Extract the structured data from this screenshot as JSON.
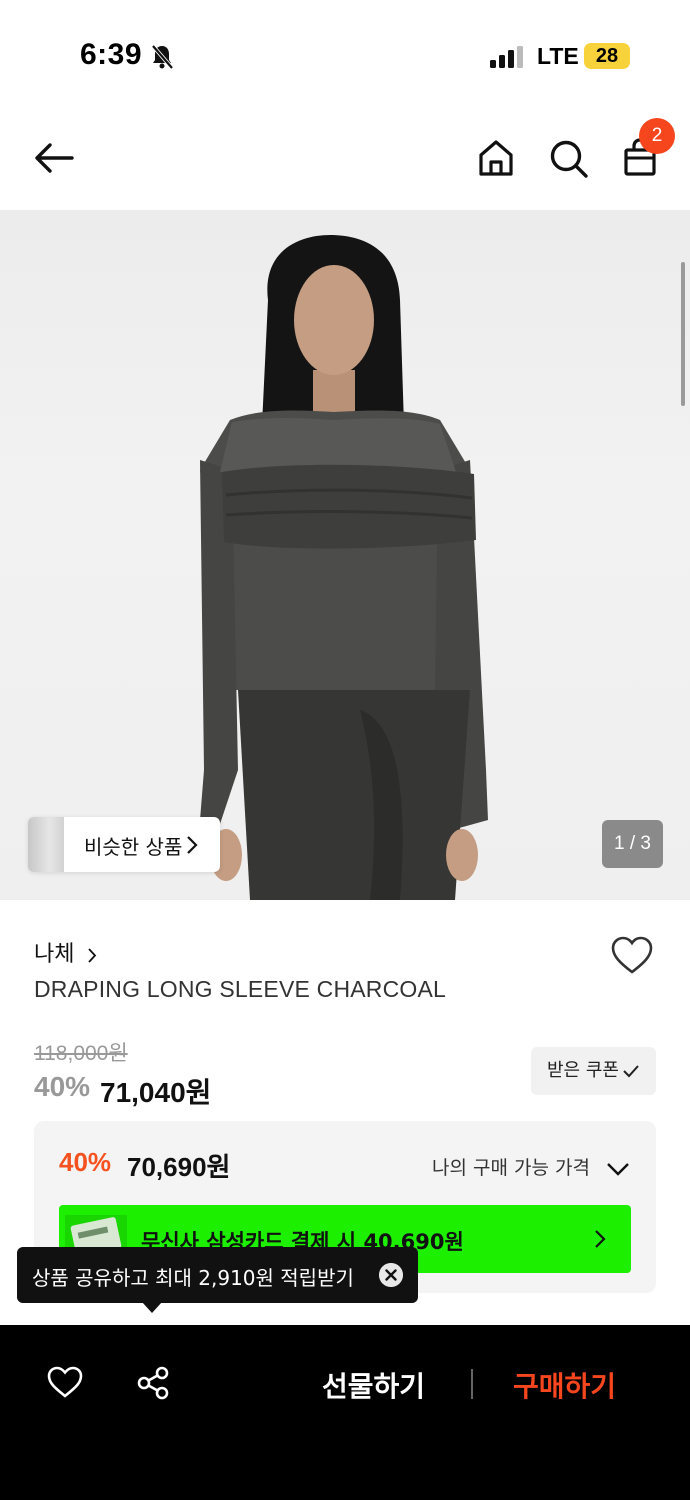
{
  "status_bar": {
    "time": "6:39",
    "network": "LTE",
    "battery": "28"
  },
  "nav": {
    "cart_count": "2"
  },
  "hero": {
    "image_counter": "1 / 3",
    "similar_label": "비슷한 상품"
  },
  "product": {
    "brand": "나체",
    "name": "DRAPING LONG SLEEVE CHARCOAL",
    "original_price": "118,000원",
    "discount_pct": "40%",
    "sale_price": "71,040원",
    "coupon_label": "받은 쿠폰"
  },
  "price_box": {
    "discount_pct": "40%",
    "price": "70,690원",
    "label": "나의 구매 가능 가격",
    "card_banner_text": "무신사 삼성카드 결제 시 40,690원"
  },
  "tooltip": {
    "text": "상품 공유하고 최대 2,910원 적립받기"
  },
  "bottom_bar": {
    "gift_label": "선물하기",
    "buy_label": "구매하기"
  },
  "colors": {
    "accent": "#f5461e",
    "card_banner": "#1cf000",
    "bottom_bar": "#000000"
  }
}
